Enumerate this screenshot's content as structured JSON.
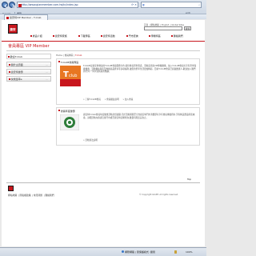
{
  "browser": {
    "url": "http://www.gianmember.com.tw/tc/index.jsp",
    "search_engine": "Google",
    "search_placeholder": "",
    "toolbar": {
      "google_label": "Google",
      "bookmarks_label": "書籤",
      "settings_label": "設定"
    },
    "tab_title": "捷安特VIP Member - T-Club",
    "status_text": "網際網路 | 受保護模式: 關閉",
    "zoom": "100%"
  },
  "site": {
    "logo_text": "捷安",
    "top_links": [
      "首頁",
      "網站地圖",
      "English",
      "Global Sites"
    ],
    "search_button": "搜尋",
    "nav": [
      "產品介紹",
      "捷安特家族",
      "下載專區",
      "捷安特活動",
      "門市查詢",
      "專欄特區",
      "聯絡我們"
    ],
    "banner_title": "會員專區 VIP Member",
    "breadcrumb_home": "Home",
    "breadcrumb_sep": "|",
    "breadcrumb_level1": "會員專區",
    "breadcrumb_current": "T-Club",
    "sidebar": {
      "header": "歡迎T-Club",
      "buttons": [
        "關於主頁面",
        "捷安特優惠",
        "快樂單車e"
      ],
      "button_suffix": "..."
    },
    "sections": [
      {
        "title": "T-CLUB會員專區",
        "body": "T-CLUB是捷安特會員的T-CLUB會員服務平台,提供會員單車資訊、活動訊息與VIP專屬優惠。加入T-CLUB會員可享有單車保養優惠、活動優先報名及專屬商品折扣等多項福利,讓您的單車生活更加精彩。目前T-CLUB會員已超過數萬人,歡迎加入我們的行列,一同享受騎乘的樂趣。",
        "links": [
          "» 了解T-CLUB會員",
          "» 會員權益說明",
          "» 加入會員"
        ]
      },
      {
        "title": "會員年度優惠",
        "body": "捷安特T-Club會員年度優惠活動熱烈展開,凡於活動期間至全台捷安特門市消費即可享有會員專屬折扣,另有精美贈品等您來拿。詳細活動內容請洽各門市或至捷安特官網查詢,數量有限送完為止。",
        "links": [
          "» 活動辦法說明"
        ]
      }
    ],
    "top_label": "Top",
    "footer_links": [
      "網站地圖",
      "隱私權政策",
      "常見問題",
      "聯絡我們"
    ],
    "copyright": "© Copyright GIANT. All rights reserved.",
    "copyright_brand": "Giant"
  },
  "colors": {
    "brand_red": "#c8161d",
    "chrome_blue": "#2d5e9e"
  }
}
